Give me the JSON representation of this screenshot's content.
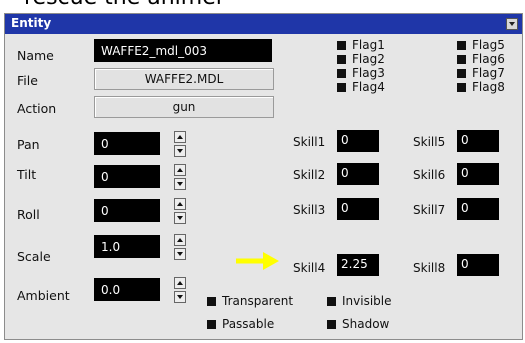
{
  "caption": "rescue the animel",
  "window": {
    "title": "Entity"
  },
  "props": {
    "name_label": "Name",
    "name_value": "WAFFE2_mdl_003",
    "file_label": "File",
    "file_value": "WAFFE2.MDL",
    "action_label": "Action",
    "action_value": "gun",
    "pan_label": "Pan",
    "pan_value": "0",
    "tilt_label": "Tilt",
    "tilt_value": "0",
    "roll_label": "Roll",
    "roll_value": "0",
    "scale_label": "Scale",
    "scale_value": "1.0",
    "ambient_label": "Ambient",
    "ambient_value": "0.0"
  },
  "flags": [
    "Flag1",
    "Flag2",
    "Flag3",
    "Flag4",
    "Flag5",
    "Flag6",
    "Flag7",
    "Flag8"
  ],
  "skills": [
    {
      "label": "Skill1",
      "value": "0"
    },
    {
      "label": "Skill2",
      "value": "0"
    },
    {
      "label": "Skill3",
      "value": "0"
    },
    {
      "label": "Skill4",
      "value": "2.25"
    },
    {
      "label": "Skill5",
      "value": "0"
    },
    {
      "label": "Skill6",
      "value": "0"
    },
    {
      "label": "Skill7",
      "value": "0"
    },
    {
      "label": "Skill8",
      "value": "0"
    }
  ],
  "options": [
    "Transparent",
    "Invisible",
    "Passable",
    "Shadow"
  ],
  "colors": {
    "titlebar": "#1f36a8",
    "panel": "#e6e6e6",
    "field": "#000000",
    "arrow": "#ffff00"
  }
}
